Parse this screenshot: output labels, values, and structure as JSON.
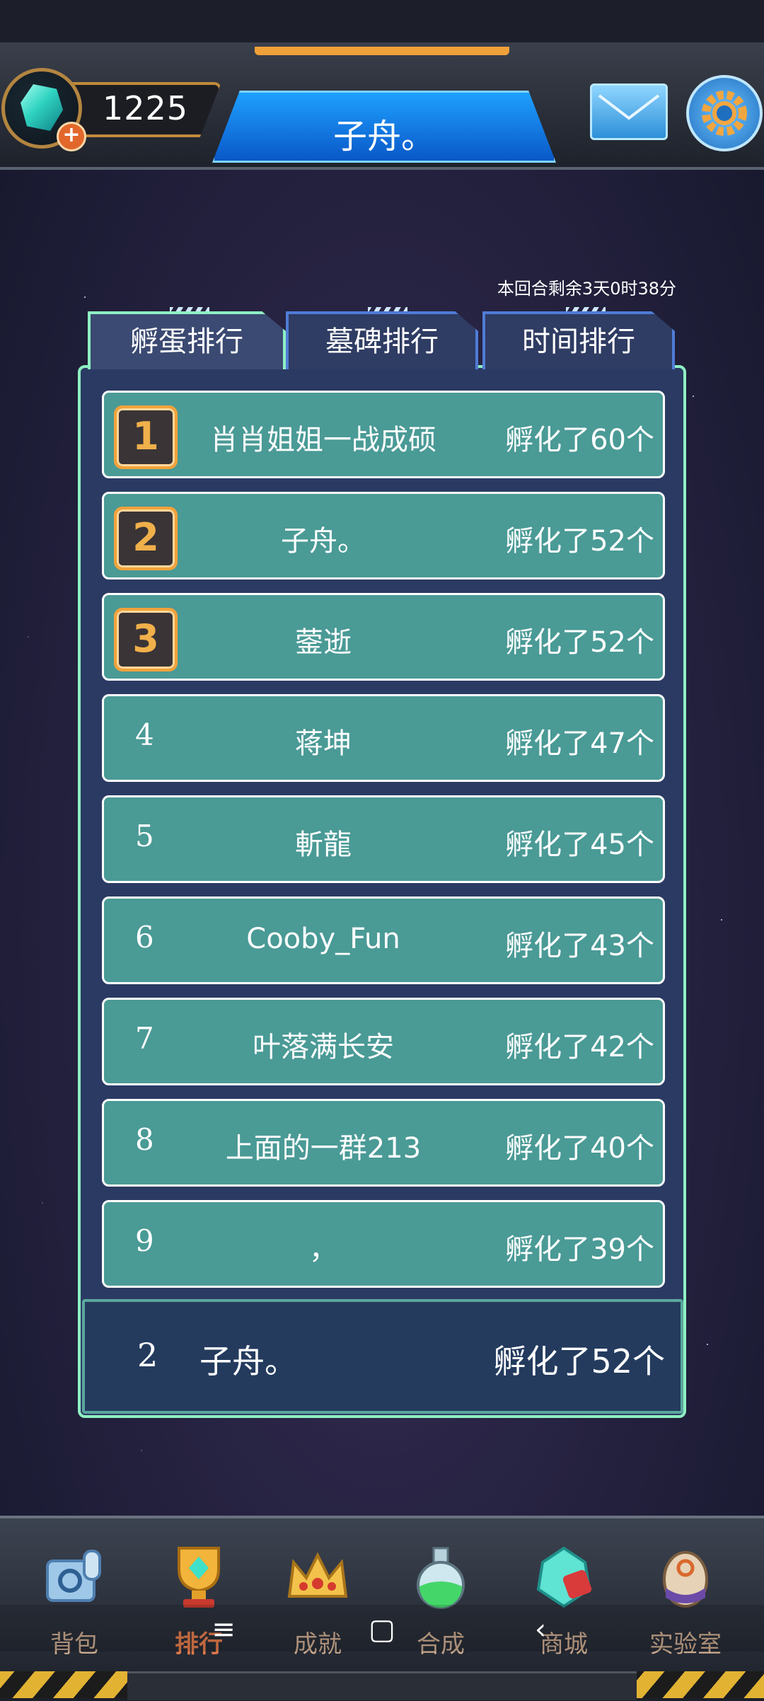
{
  "header": {
    "currency_value": "1225",
    "player_name": "子舟。"
  },
  "panel": {
    "round_timer": "本回合剩余3天0时38分",
    "tabs": [
      {
        "label": "孵蛋排行",
        "active": true
      },
      {
        "label": "墓碑排行",
        "active": false
      },
      {
        "label": "时间排行",
        "active": false
      }
    ],
    "rows": [
      {
        "rank": "1",
        "name": "肖肖姐姐一战成硕",
        "score": "孵化了60个"
      },
      {
        "rank": "2",
        "name": "子舟。",
        "score": "孵化了52个"
      },
      {
        "rank": "3",
        "name": "蓥逝",
        "score": "孵化了52个"
      },
      {
        "rank": "4",
        "name": "蒋坤",
        "score": "孵化了47个"
      },
      {
        "rank": "5",
        "name": "斬龍",
        "score": "孵化了45个"
      },
      {
        "rank": "6",
        "name": "Cooby_Fun",
        "score": "孵化了43个"
      },
      {
        "rank": "7",
        "name": "叶落满长安",
        "score": "孵化了42个"
      },
      {
        "rank": "8",
        "name": "上面的一群213",
        "score": "孵化了40个"
      },
      {
        "rank": "9",
        "name": "，",
        "score": "孵化了39个"
      }
    ],
    "my_rank": {
      "rank": "2",
      "name": "子舟。",
      "score": "孵化了52个"
    }
  },
  "nav": {
    "items": [
      {
        "label": "背包",
        "icon": "backpack-icon"
      },
      {
        "label": "排行",
        "icon": "trophy-icon",
        "active": true
      },
      {
        "label": "成就",
        "icon": "crown-icon"
      },
      {
        "label": "合成",
        "icon": "potion-flask-icon"
      },
      {
        "label": "商城",
        "icon": "crystal-shop-icon"
      },
      {
        "label": "实验室",
        "icon": "egg-lab-icon"
      }
    ]
  },
  "system_nav": {
    "menu_glyph": "≡",
    "home_glyph": "▢",
    "back_glyph": "‹"
  },
  "colors": {
    "row_bg": "#4a9a96",
    "panel_border": "#8ef0c2",
    "medal_gold": "#f3a23a",
    "active_nav": "#e07a4a"
  }
}
